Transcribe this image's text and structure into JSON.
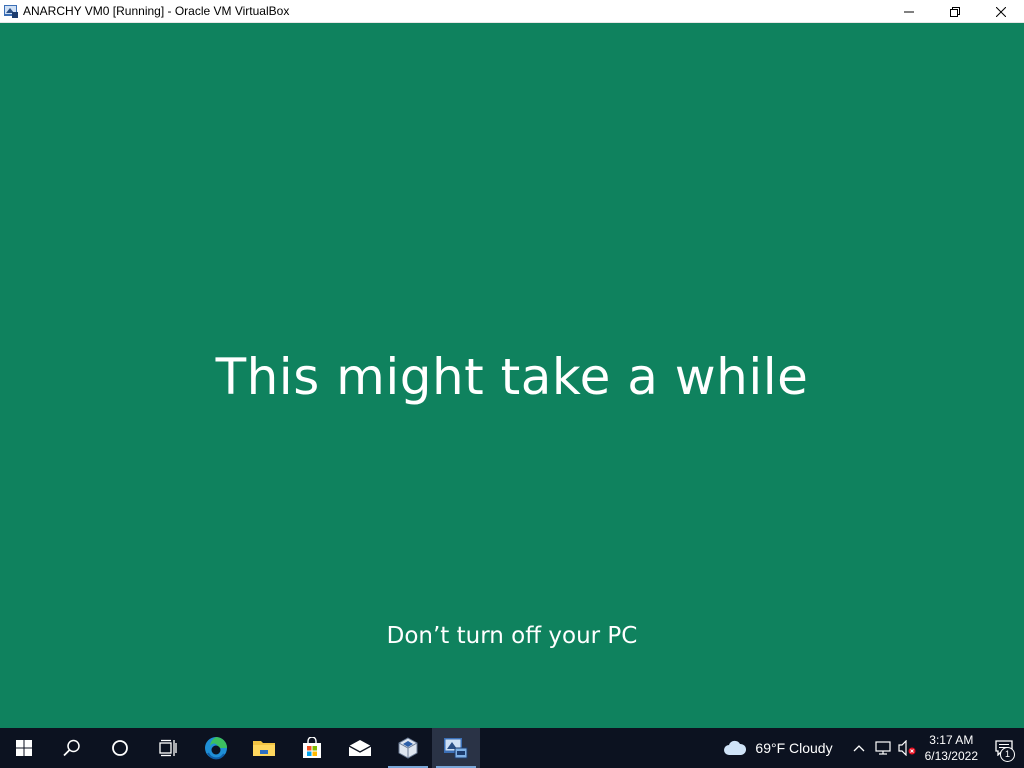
{
  "window": {
    "title": "ANARCHY VM0 [Running] - Oracle VM VirtualBox",
    "app_icon": "virtualbox-vm-icon",
    "controls": [
      "minimize-icon",
      "restore-icon",
      "close-icon"
    ]
  },
  "screen": {
    "background_color": "#0f825e",
    "headline": "This might take a while",
    "subline": "Don’t turn off your PC"
  },
  "taskbar": {
    "buttons": [
      {
        "name": "start-button",
        "icon": "windows-logo-icon"
      },
      {
        "name": "search-button",
        "icon": "search-icon"
      },
      {
        "name": "cortana-button",
        "icon": "circle-icon"
      },
      {
        "name": "task-view-button",
        "icon": "task-view-icon"
      },
      {
        "name": "edge-button",
        "icon": "edge-icon"
      },
      {
        "name": "file-explorer-button",
        "icon": "folder-icon"
      },
      {
        "name": "store-button",
        "icon": "store-bag-icon"
      },
      {
        "name": "mail-button",
        "icon": "mail-icon"
      },
      {
        "name": "virtualbox-button",
        "icon": "virtualbox-cube-icon",
        "running": true
      },
      {
        "name": "vm-window-button",
        "icon": "virtualbox-vm-icon",
        "running": true,
        "active": true
      }
    ],
    "weather": {
      "icon": "cloud-icon",
      "text": "69°F  Cloudy"
    },
    "tray": {
      "icons": [
        "chevron-up-icon",
        "network-icon",
        "volume-muted-icon"
      ],
      "time": "3:17 AM",
      "date": "6/13/2022",
      "notifications": {
        "icon": "notification-icon",
        "count": "1"
      }
    }
  }
}
